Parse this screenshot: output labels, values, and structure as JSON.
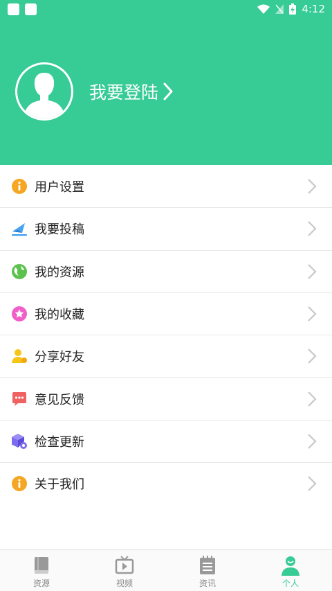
{
  "status_bar": {
    "time": "4:12"
  },
  "header": {
    "login_label": "我要登陆"
  },
  "menu": [
    {
      "label": "用户设置",
      "icon": "info-icon",
      "color": "#f5a623"
    },
    {
      "label": "我要投稿",
      "icon": "paper-plane-icon",
      "color": "#4aa3f0"
    },
    {
      "label": "我的资源",
      "icon": "globe-icon",
      "color": "#5cc24e"
    },
    {
      "label": "我的收藏",
      "icon": "star-icon",
      "color": "#f05fc8"
    },
    {
      "label": "分享好友",
      "icon": "user-share-icon",
      "color": "#f5c518"
    },
    {
      "label": "意见反馈",
      "icon": "chat-icon",
      "color": "#f06262"
    },
    {
      "label": "检查更新",
      "icon": "box-gear-icon",
      "color": "#7b6cf0"
    },
    {
      "label": "关于我们",
      "icon": "info-icon",
      "color": "#f5a623"
    }
  ],
  "tabs": [
    {
      "label": "资源",
      "icon": "book-icon",
      "active": false
    },
    {
      "label": "视频",
      "icon": "tv-icon",
      "active": false
    },
    {
      "label": "资讯",
      "icon": "notepad-icon",
      "active": false
    },
    {
      "label": "个人",
      "icon": "person-icon",
      "active": true
    }
  ],
  "colors": {
    "brand": "#37cb96",
    "inactive_tab": "#888888"
  }
}
